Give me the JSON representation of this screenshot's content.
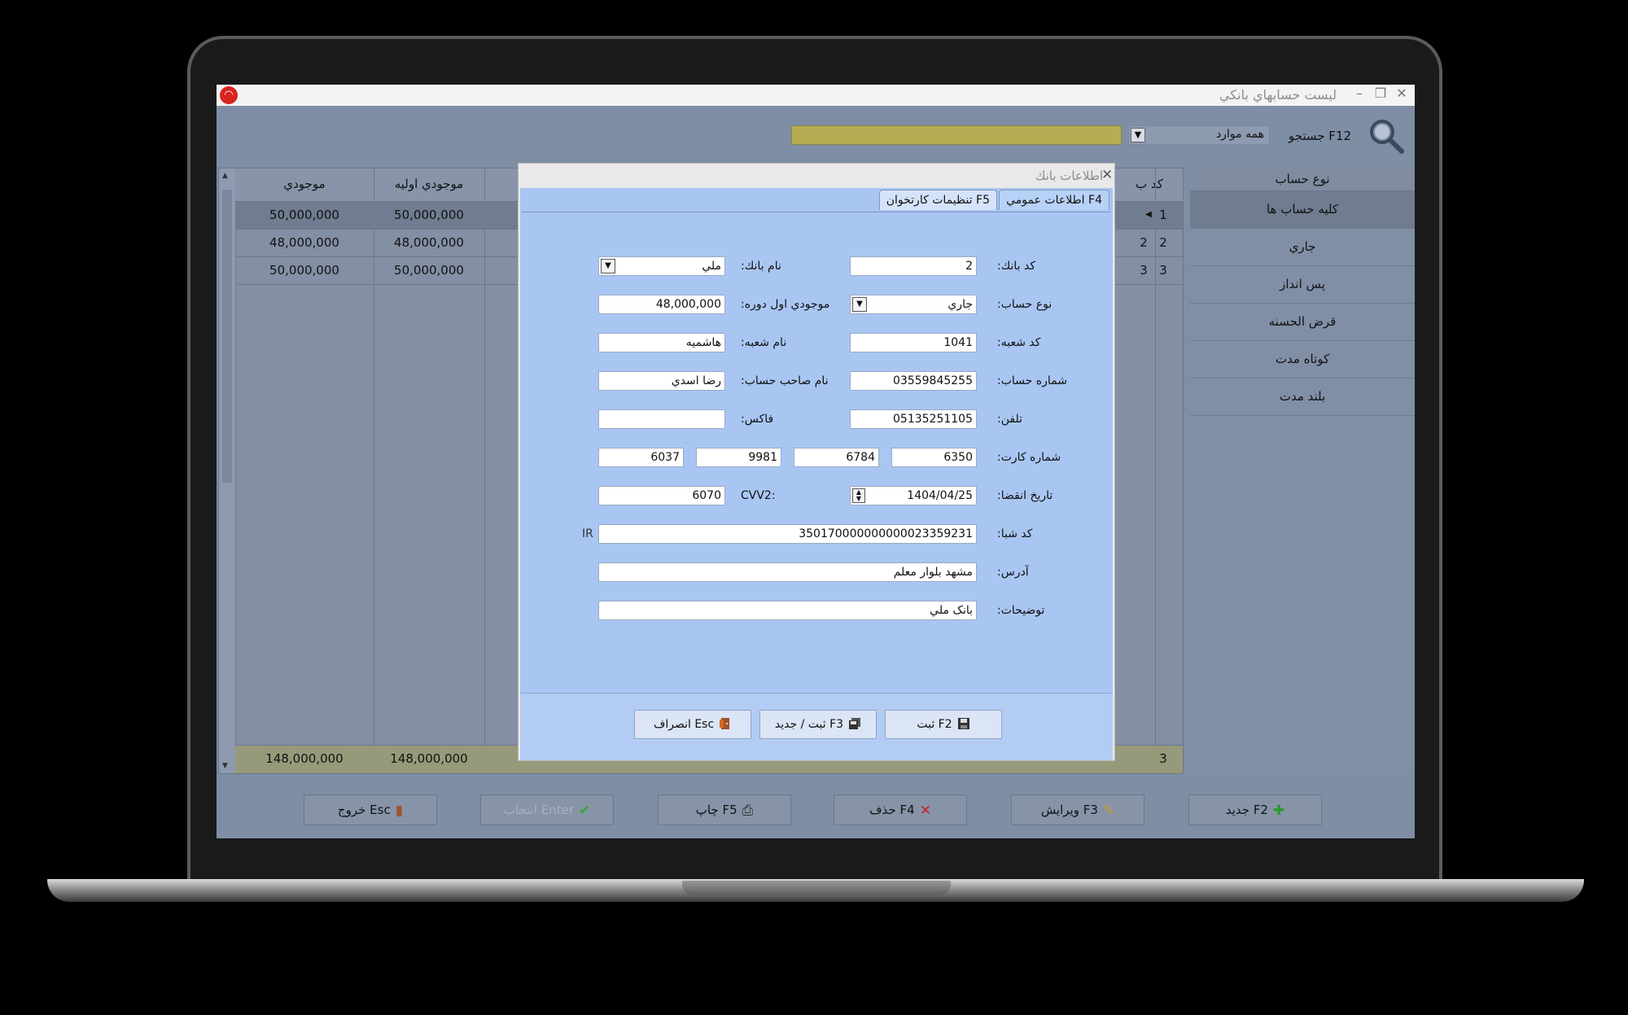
{
  "window": {
    "title": "ليست حسابهاي بانكي",
    "logo": "◠"
  },
  "toolbar": {
    "search_label": "جستجو F12",
    "scope_value": "همه موارد",
    "search_value": ""
  },
  "sidebar": {
    "header": "نوع حساب",
    "items": [
      {
        "label": "كليه حساب ها"
      },
      {
        "label": "جاري"
      },
      {
        "label": "پس انداز"
      },
      {
        "label": "قرض الحسنه"
      },
      {
        "label": "كوتاه مدت"
      },
      {
        "label": "بلند مدت"
      }
    ]
  },
  "grid": {
    "columns": {
      "balance": "موجودي",
      "initial": "موجودي اوليه",
      "code": "كد ب"
    },
    "rows": [
      {
        "num": "1",
        "balance": "50,000,000",
        "initial": "50,000,000",
        "code": ""
      },
      {
        "num": "2",
        "balance": "48,000,000",
        "initial": "48,000,000",
        "code": "2"
      },
      {
        "num": "3",
        "balance": "50,000,000",
        "initial": "50,000,000",
        "code": "3"
      }
    ],
    "totals": {
      "balance": "148,000,000",
      "initial": "148,000,000",
      "count": "3"
    }
  },
  "actions": {
    "new": "جديد F2",
    "edit": "ويرايش F3",
    "delete": "حذف F4",
    "print": "چاپ F5",
    "select": "انتخاب Enter",
    "exit": "خروج Esc"
  },
  "dialog": {
    "title": "اطلاعات بانك",
    "tabs": {
      "general": "اطلاعات عمومي F4",
      "reader": "تنظيمات كارتخوان F5"
    },
    "labels": {
      "bank_code": "كد بانك:",
      "bank_name": "نام بانك:",
      "account_type": "نوع حساب:",
      "opening_balance": "موجودي اول دوره:",
      "branch_code": "كد شعبه:",
      "branch_name": "نام شعبه:",
      "account_number": "شماره حساب:",
      "holder_name": "نام صاحب حساب:",
      "phone": "تلفن:",
      "fax": "فاكس:",
      "card_number": "شماره كارت:",
      "expiry": "تاريخ انقضا:",
      "cvv2": "CVV2:",
      "sheba": "كد شبا:",
      "sheba_prefix": "IR",
      "address": "آدرس:",
      "notes": "توضيحات:"
    },
    "values": {
      "bank_code": "2",
      "bank_name": "ملي",
      "account_type": "جاري",
      "opening_balance": "48,000,000",
      "branch_code": "1041",
      "branch_name": "هاشميه",
      "account_number": "03559845255",
      "holder_name": "رضا اسدي",
      "phone": "05135251105",
      "fax": "",
      "card_1": "6350",
      "card_2": "6784",
      "card_3": "9981",
      "card_4": "6037",
      "expiry": "1404/04/25",
      "cvv2": "6070",
      "sheba": "350170000000000023359231",
      "address": "مشهد بلوار معلم",
      "notes": "بانک ملي"
    },
    "buttons": {
      "save": "ثبت F2",
      "save_new": "ثبت / جديد F3",
      "cancel": "انصراف Esc"
    }
  },
  "colors": {
    "grid_bg": "#838fa3",
    "dialog_bg": "#a9c6f3",
    "search_bg": "#b5ad53",
    "add_green": "#2a9a2a",
    "delete_red": "#c81e1e"
  }
}
